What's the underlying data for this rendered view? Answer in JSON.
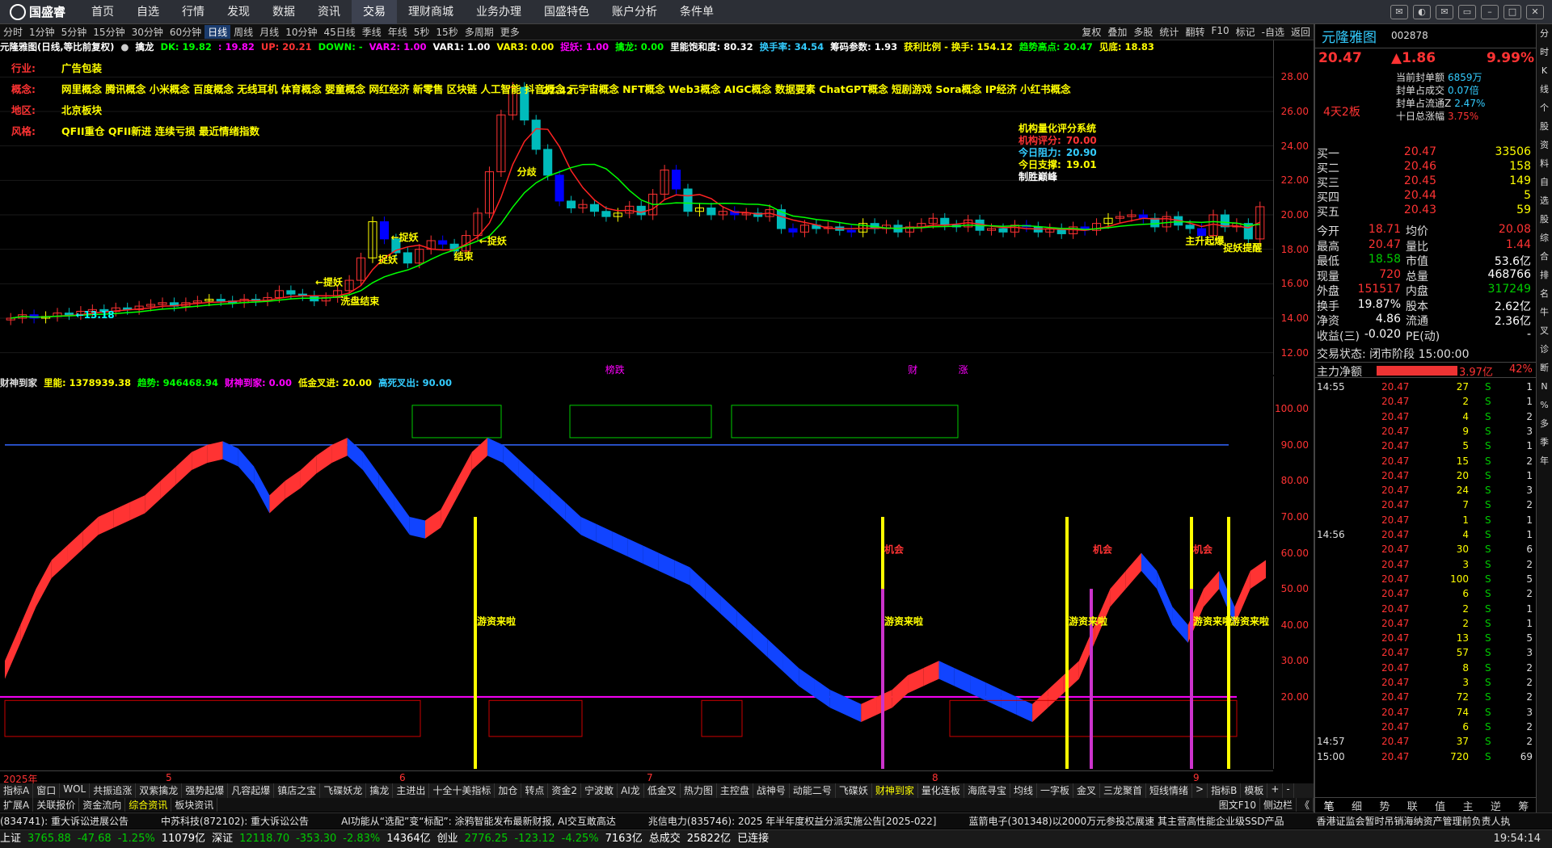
{
  "nav": {
    "logo": "国盛睿",
    "items": [
      "首页",
      "自选",
      "行情",
      "发现",
      "数据",
      "资讯",
      "交易",
      "理财商城",
      "业务办理",
      "国盛特色",
      "账户分析",
      "条件单"
    ],
    "active_index": 6
  },
  "period": {
    "items": [
      "分时",
      "1分钟",
      "5分钟",
      "15分钟",
      "30分钟",
      "60分钟",
      "日线",
      "周线",
      "月线",
      "10分钟",
      "45日线",
      "季线",
      "年线",
      "5秒",
      "15秒",
      "多周期",
      "更多"
    ],
    "active": "日线",
    "right": [
      "复权",
      "叠加",
      "多股",
      "统计",
      "翻转",
      "F10",
      "标记",
      "-自选",
      "返回"
    ]
  },
  "indicator1": [
    {
      "t": "元隆雅图(日线,等比前复权)",
      "c": "#fff"
    },
    {
      "t": "●",
      "c": "#ccc"
    },
    {
      "t": "擒龙",
      "c": "#fff"
    },
    {
      "t": "DK: 19.82",
      "c": "#0f0"
    },
    {
      "t": ": 19.82",
      "c": "#f0f"
    },
    {
      "t": "UP: 20.21",
      "c": "#f33"
    },
    {
      "t": "DOWN: -",
      "c": "#0f0"
    },
    {
      "t": "VAR2: 1.00",
      "c": "#f0f"
    },
    {
      "t": "VAR1: 1.00",
      "c": "#fff"
    },
    {
      "t": "VAR3: 0.00",
      "c": "#ff0"
    },
    {
      "t": "捉妖: 1.00",
      "c": "#f0f"
    },
    {
      "t": "擒龙: 0.00",
      "c": "#0f0"
    },
    {
      "t": "里能饱和度: 80.32",
      "c": "#fff"
    },
    {
      "t": "换手率: 34.54",
      "c": "#3cf"
    },
    {
      "t": "筹码参数: 1.93",
      "c": "#fff"
    },
    {
      "t": "获利比例 - 换手: 154.12",
      "c": "#ff0"
    },
    {
      "t": "趋势高点: 20.47",
      "c": "#0f0"
    },
    {
      "t": "见底: 18.83",
      "c": "#ff0"
    }
  ],
  "concepts": [
    {
      "k": "行业:",
      "v": "广告包装"
    },
    {
      "k": "概念:",
      "v": "网里概念 腾讯概念 小米概念 百度概念 无线耳机 体育概念 婴童概念 网红经济 新零售 区块链 人工智能 抖音概念 元宇宙概念 NFT概念 Web3概念 AIGC概念 数据要素 ChatGPT概念 短剧游戏 Sora概念 IP经济 小红书概念"
    },
    {
      "k": "地区:",
      "v": "北京板块"
    },
    {
      "k": "风格:",
      "v": "QFII重仓 QFII新进 连续亏损 最近情绪指数"
    }
  ],
  "rating": {
    "title": "机构量化评分系统",
    "rows": [
      {
        "k": "机构评分:",
        "v": "70.00",
        "c": "#f33"
      },
      {
        "k": "今日阻力:",
        "v": "20.90",
        "c": "#3cf"
      },
      {
        "k": "今日支撑:",
        "v": "19.01",
        "c": "#ff0"
      },
      {
        "k": "制胜巅峰",
        "v": "",
        "c": "#fff"
      }
    ]
  },
  "chart_data": [
    {
      "type": "candlestick",
      "title": "元隆雅图(日线,等比前复权)",
      "ylim": [
        11,
        29
      ],
      "yticks": [
        12.0,
        14.0,
        16.0,
        18.0,
        20.0,
        22.0,
        24.0,
        26.0,
        28.0
      ],
      "closes": [
        14.0,
        14.2,
        14.0,
        14.1,
        14.3,
        14.2,
        14.4,
        14.5,
        14.4,
        14.6,
        14.5,
        14.7,
        14.8,
        14.9,
        14.7,
        14.9,
        15.0,
        15.1,
        15.0,
        14.9,
        15.1,
        15.0,
        15.2,
        15.6,
        15.4,
        15.3,
        15.0,
        15.2,
        15.6,
        16.2,
        17.5,
        19.6,
        18.6,
        17.8,
        17.2,
        18.0,
        18.5,
        18.3,
        17.9,
        18.8,
        20.1,
        22.5,
        25.8,
        27.4,
        25.5,
        23.8,
        22.3,
        20.8,
        20.4,
        20.6,
        20.2,
        19.9,
        20.1,
        20.5,
        20.0,
        21.2,
        22.6,
        21.5,
        20.2,
        20.4,
        20.0,
        20.2,
        20.0,
        20.1,
        19.9,
        20.3,
        19.2,
        19.0,
        19.4,
        19.2,
        19.3,
        19.1,
        19.0,
        19.5,
        19.2,
        19.4,
        19.0,
        19.3,
        19.5,
        19.8,
        19.4,
        19.3,
        19.7,
        19.1,
        19.2,
        19.0,
        19.4,
        19.3,
        19.0,
        19.2,
        18.9,
        19.3,
        19.1,
        19.5,
        19.8,
        19.9,
        20.0,
        19.8,
        19.3,
        19.9,
        19.4,
        19.2,
        18.8,
        20.0,
        19.3,
        19.5,
        18.6,
        20.47
      ],
      "labels": [
        "←13.18",
        "←提妖",
        "洗盘结束",
        "←捉妖",
        "捉妖",
        "结束",
        "←捉妖",
        "27.42",
        "分歧",
        "主升起爆",
        "捉妖提醒"
      ],
      "bottom_labels": [
        "榜跌",
        "财",
        "涨"
      ]
    },
    {
      "type": "area",
      "title": "财神到家",
      "ylim": [
        0,
        105
      ],
      "yticks": [
        20.0,
        30.0,
        40.0,
        50.0,
        60.0,
        70.0,
        80.0,
        90.0,
        100.0
      ],
      "series_label": {
        "name": "财神到家",
        "items": [
          {
            "t": "里能: 1378939.38",
            "c": "#ff0"
          },
          {
            "t": "趋势: 946468.94",
            "c": "#0f0"
          },
          {
            "t": "财神到家: 0.00",
            "c": "#f0f"
          },
          {
            "t": "低金叉进: 20.00",
            "c": "#ff0"
          },
          {
            "t": "高死叉出: 90.00",
            "c": "#3cf"
          }
        ]
      },
      "values": [
        30,
        40,
        50,
        58,
        62,
        66,
        70,
        72,
        74,
        76,
        80,
        84,
        88,
        90,
        91,
        89,
        84,
        76,
        80,
        83,
        87,
        90,
        92,
        88,
        82,
        76,
        70,
        69,
        72,
        80,
        88,
        92,
        90,
        86,
        82,
        78,
        74,
        70,
        68,
        66,
        64,
        62,
        60,
        58,
        56,
        52,
        48,
        44,
        40,
        36,
        32,
        28,
        25,
        22,
        20,
        18,
        20,
        22,
        26,
        28,
        30,
        28,
        26,
        24,
        22,
        20,
        18,
        22,
        26,
        30,
        40,
        50,
        55,
        60,
        55,
        45,
        40,
        50,
        55,
        45,
        55,
        58
      ],
      "annotations": [
        "游资来啦",
        "游资来啦",
        "游资来啦",
        "游资来啦",
        "游资来啦",
        "机会",
        "机会",
        "机会"
      ]
    }
  ],
  "xaxis": {
    "labels": [
      "2025年",
      "5",
      "6",
      "7",
      "8",
      "9"
    ]
  },
  "quote": {
    "name": "元隆雅图",
    "code": "002878",
    "price": "20.47",
    "change": "▲1.86",
    "pct": "9.99%",
    "streak": "4天2板",
    "seal": [
      {
        "k": "当前封单额",
        "v": "6859万"
      },
      {
        "k": "封单占成交",
        "v": "0.07倍"
      },
      {
        "k": "封单占流通Z",
        "v": "2.47%"
      },
      {
        "k": "十日总涨幅",
        "v": "3.75%"
      }
    ],
    "book": [
      {
        "l": "买一",
        "p": "20.47",
        "q": "33506"
      },
      {
        "l": "买二",
        "p": "20.46",
        "q": "158"
      },
      {
        "l": "买三",
        "p": "20.45",
        "q": "149"
      },
      {
        "l": "买四",
        "p": "20.44",
        "q": "5"
      },
      {
        "l": "买五",
        "p": "20.43",
        "q": "59"
      }
    ],
    "stats": [
      {
        "l1": "今开",
        "v1": "18.71",
        "c1": "red",
        "l2": "均价",
        "v2": "20.08",
        "c2": "red"
      },
      {
        "l1": "最高",
        "v1": "20.47",
        "c1": "red",
        "l2": "量比",
        "v2": "1.44",
        "c2": "red"
      },
      {
        "l1": "最低",
        "v1": "18.58",
        "c1": "grn",
        "l2": "市值",
        "v2": "53.6亿",
        "c2": "wht"
      },
      {
        "l1": "现量",
        "v1": "720",
        "c1": "red",
        "l2": "总量",
        "v2": "468766",
        "c2": "wht"
      },
      {
        "l1": "外盘",
        "v1": "151517",
        "c1": "red",
        "l2": "内盘",
        "v2": "317249",
        "c2": "grn"
      },
      {
        "l1": "换手",
        "v1": "19.87%",
        "c1": "wht",
        "l2": "股本",
        "v2": "2.62亿",
        "c2": "wht"
      },
      {
        "l1": "净资",
        "v1": "4.86",
        "c1": "wht",
        "l2": "流通",
        "v2": "2.36亿",
        "c2": "wht"
      },
      {
        "l1": "收益(三)",
        "v1": "-0.020",
        "c1": "wht",
        "l2": "PE(动)",
        "v2": "-",
        "c2": "wht"
      }
    ],
    "trade_state": "交易状态: 闭市阶段 15:00:00",
    "main_flow": {
      "label": "主力净额",
      "value": "3.97亿",
      "pct": "42%"
    },
    "ticks": [
      {
        "t": "14:55",
        "p": "20.47",
        "v": "27",
        "n": "1"
      },
      {
        "t": "",
        "p": "20.47",
        "v": "2",
        "n": "1"
      },
      {
        "t": "",
        "p": "20.47",
        "v": "4",
        "n": "2"
      },
      {
        "t": "",
        "p": "20.47",
        "v": "9",
        "n": "3"
      },
      {
        "t": "",
        "p": "20.47",
        "v": "5",
        "n": "1"
      },
      {
        "t": "",
        "p": "20.47",
        "v": "15",
        "n": "2"
      },
      {
        "t": "",
        "p": "20.47",
        "v": "20",
        "n": "1"
      },
      {
        "t": "",
        "p": "20.47",
        "v": "24",
        "n": "3"
      },
      {
        "t": "",
        "p": "20.47",
        "v": "7",
        "n": "2"
      },
      {
        "t": "",
        "p": "20.47",
        "v": "1",
        "n": "1"
      },
      {
        "t": "14:56",
        "p": "20.47",
        "v": "4",
        "n": "1"
      },
      {
        "t": "",
        "p": "20.47",
        "v": "30",
        "n": "6"
      },
      {
        "t": "",
        "p": "20.47",
        "v": "3",
        "n": "2"
      },
      {
        "t": "",
        "p": "20.47",
        "v": "100",
        "n": "5"
      },
      {
        "t": "",
        "p": "20.47",
        "v": "6",
        "n": "2"
      },
      {
        "t": "",
        "p": "20.47",
        "v": "2",
        "n": "1"
      },
      {
        "t": "",
        "p": "20.47",
        "v": "2",
        "n": "1"
      },
      {
        "t": "",
        "p": "20.47",
        "v": "13",
        "n": "5"
      },
      {
        "t": "",
        "p": "20.47",
        "v": "57",
        "n": "3"
      },
      {
        "t": "",
        "p": "20.47",
        "v": "8",
        "n": "2"
      },
      {
        "t": "",
        "p": "20.47",
        "v": "3",
        "n": "2"
      },
      {
        "t": "",
        "p": "20.47",
        "v": "72",
        "n": "2"
      },
      {
        "t": "",
        "p": "20.47",
        "v": "74",
        "n": "3"
      },
      {
        "t": "",
        "p": "20.47",
        "v": "6",
        "n": "2"
      },
      {
        "t": "14:57",
        "p": "20.47",
        "v": "37",
        "n": "2"
      },
      {
        "t": "15:00",
        "p": "20.47",
        "v": "720",
        "n": "69"
      }
    ],
    "bottom_tabs": [
      "笔",
      "细",
      "势",
      "联",
      "值",
      "主",
      "逆",
      "筹"
    ]
  },
  "tabs1": [
    "指标A",
    "窗口",
    "WOL",
    "共振追涨",
    "双紫擒龙",
    "强势起爆",
    "凡容起爆",
    "镇店之宝",
    "飞碟妖龙",
    "擒龙",
    "主进出",
    "十全十美指标",
    "加仓",
    "转点",
    "资金2",
    "宁波敢",
    "AI龙",
    "低金叉",
    "热力图",
    "主控盘",
    "战神号",
    "动能二号",
    "飞碟妖",
    "财神到家",
    "量化连板",
    "海底寻宝",
    "均线",
    "一字板",
    "金叉",
    "三龙聚首",
    "短线情绪",
    ">",
    "指标B",
    "模板",
    "+",
    "-"
  ],
  "tabs1_active": "财神到家",
  "tabs2": [
    "扩展A",
    "关联报价",
    "资金流向",
    "综合资讯",
    "板块资讯"
  ],
  "tabs2_right": [
    "图文F10",
    "侧边栏",
    "《"
  ],
  "news": [
    "(834741): 重大诉讼进展公告",
    "中苏科技(872102): 重大诉讼公告",
    "AI功能从“选配”变“标配”: 涂鸦智能发布最新财报, AI交互敢高达",
    "兆信电力(835746): 2025 年半年度权益分派实施公告[2025-022]",
    "蓝箭电子(301348)以2000万元参投芯展速 其主营高性能企业级SSD产品",
    "香港证监会暂时吊销海纳资产管理前负责人执"
  ],
  "status": {
    "items": [
      {
        "t": "上证",
        "c": "#fff"
      },
      {
        "t": "3765.88",
        "c": "#0c0"
      },
      {
        "t": "-47.68",
        "c": "#0c0"
      },
      {
        "t": "-1.25%",
        "c": "#0c0"
      },
      {
        "t": "11079亿",
        "c": "#fff"
      },
      {
        "t": "深证",
        "c": "#fff"
      },
      {
        "t": "12118.70",
        "c": "#0c0"
      },
      {
        "t": "-353.30",
        "c": "#0c0"
      },
      {
        "t": "-2.83%",
        "c": "#0c0"
      },
      {
        "t": "14364亿",
        "c": "#fff"
      },
      {
        "t": "创业",
        "c": "#fff"
      },
      {
        "t": "2776.25",
        "c": "#0c0"
      },
      {
        "t": "-123.12",
        "c": "#0c0"
      },
      {
        "t": "-4.25%",
        "c": "#0c0"
      },
      {
        "t": "7163亿",
        "c": "#fff"
      },
      {
        "t": "总成交",
        "c": "#fff"
      },
      {
        "t": "25822亿",
        "c": "#fff"
      },
      {
        "t": "已连接",
        "c": "#fff"
      }
    ],
    "time": "19:54:14"
  },
  "sidebar": [
    "分",
    "时",
    "K",
    "线",
    "个",
    "股",
    "资",
    "料",
    "自",
    "选",
    "股",
    "综",
    "合",
    "排",
    "名",
    "牛",
    "叉",
    "诊",
    "断",
    "N",
    "%",
    "多",
    "季",
    "年"
  ]
}
